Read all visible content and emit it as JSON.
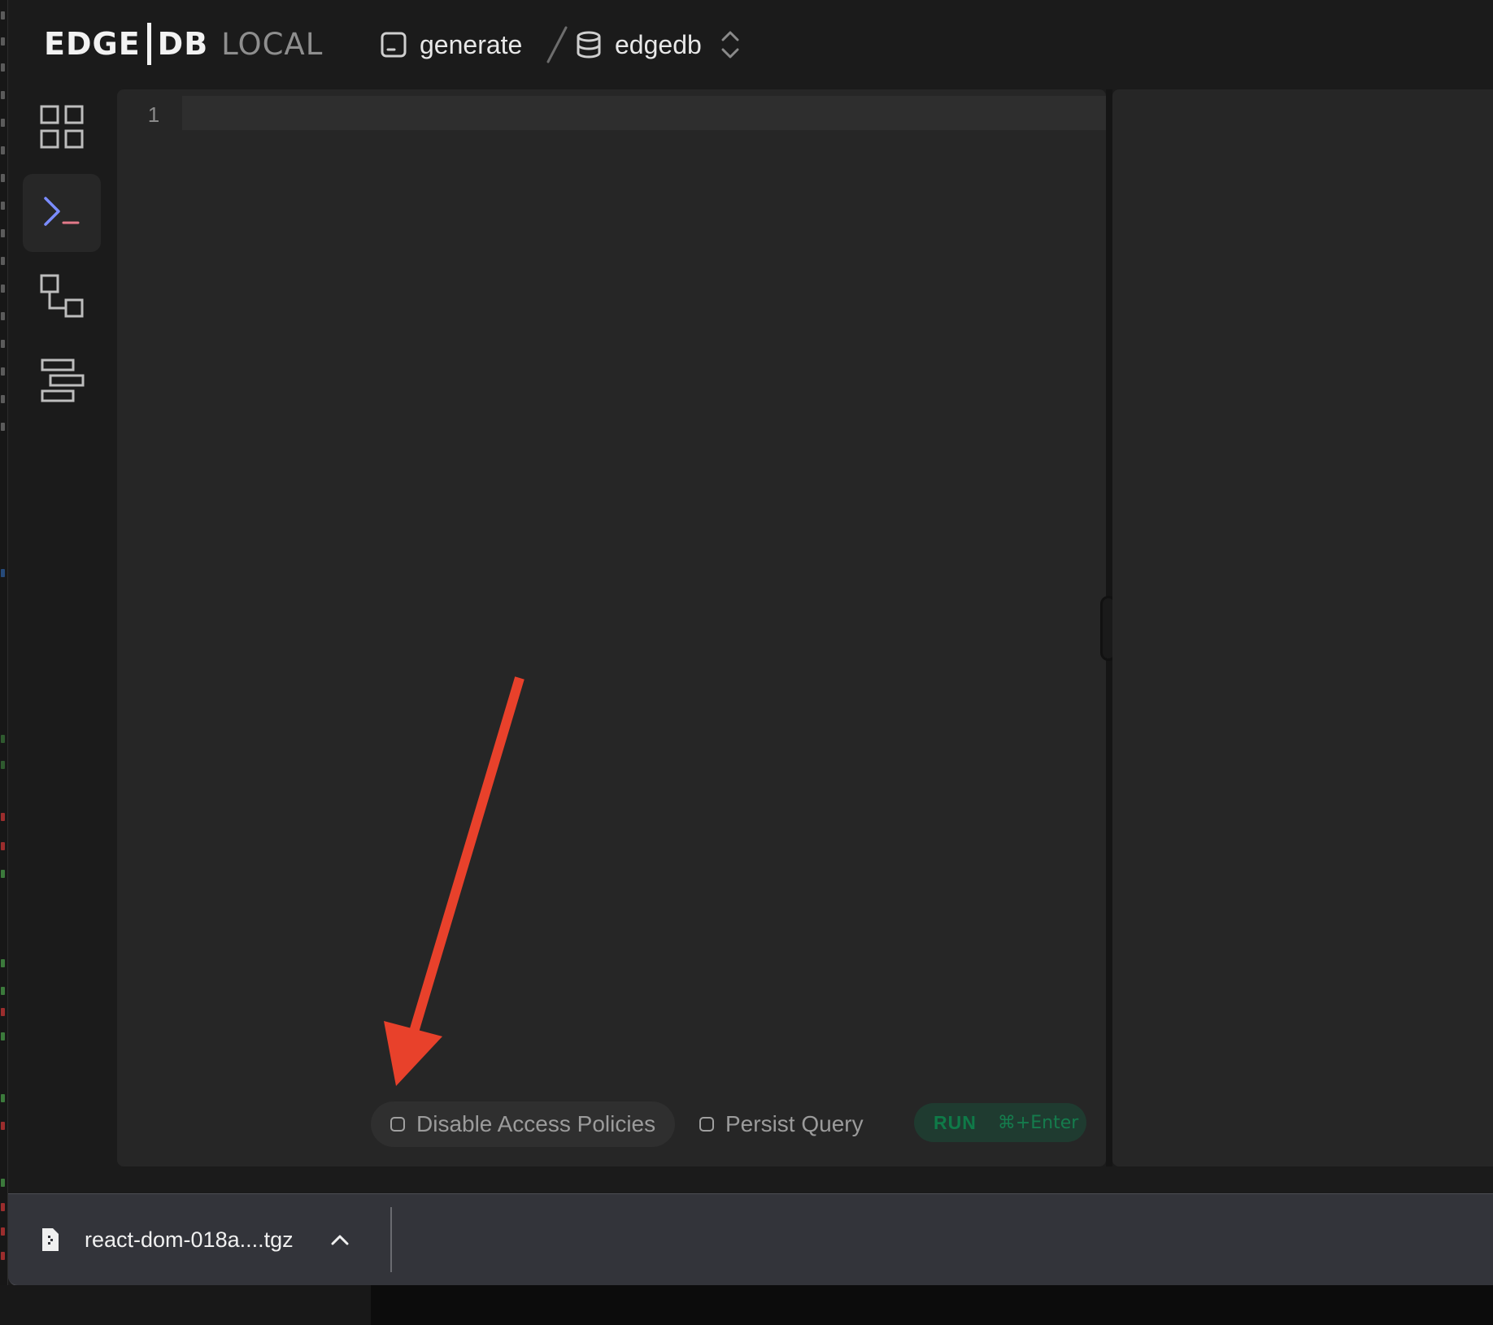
{
  "header": {
    "logo_edge": "EDGE",
    "logo_db": "DB",
    "logo_local": "LOCAL",
    "instance_name": "generate",
    "database_name": "edgedb"
  },
  "nav": [
    {
      "name": "dashboard",
      "icon": "grid-icon"
    },
    {
      "name": "repl",
      "icon": "terminal-prompt-icon",
      "active": true
    },
    {
      "name": "schema",
      "icon": "schema-graph-icon"
    },
    {
      "name": "data-explorer",
      "icon": "data-table-icon"
    }
  ],
  "editor": {
    "line_numbers": [
      "1"
    ],
    "content": ""
  },
  "controls": {
    "disable_access_policies_label": "Disable Access Policies",
    "disable_access_policies_checked": false,
    "persist_query_label": "Persist Query",
    "persist_query_checked": false,
    "run_label": "RUN",
    "run_shortcut": "⌘+Enter"
  },
  "download_bar": {
    "filename": "react-dom-018a....tgz"
  },
  "colors": {
    "background": "#1b1b1b",
    "panel": "#262626",
    "accent_blue": "#7a8cff",
    "accent_pink": "#e47a8a",
    "run_bg": "#1f3b30",
    "run_text": "#0f7a48",
    "annotation_red": "#e8412b"
  }
}
